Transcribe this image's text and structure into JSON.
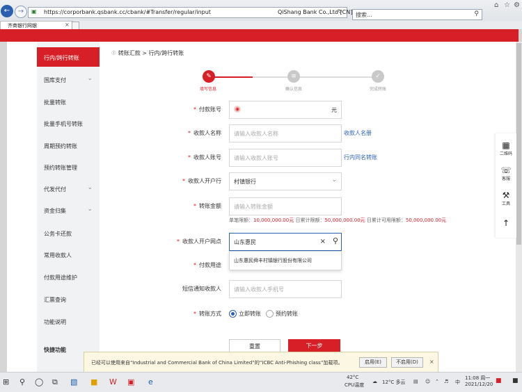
{
  "browser": {
    "url": "https://corporbank.qsbank.cc/cbank/#Transfer/regular/input",
    "cert_name": "QiShang Bank Co.,Ltd [CN]",
    "search_placeholder": "搜索...",
    "tab_title": "齐商银行网银"
  },
  "breadcrumb": "转账汇款 > 行内/跨行转账",
  "sidebar": {
    "items": [
      {
        "label": "行内/跨行转账",
        "active": true
      },
      {
        "label": "国库支付",
        "has_chevron": true
      },
      {
        "label": "批量转账"
      },
      {
        "label": "批量手机号转账"
      },
      {
        "label": "周期预约转账"
      },
      {
        "label": "预约转账管理"
      },
      {
        "label": "代发代付",
        "has_chevron": true
      },
      {
        "label": "资金归集",
        "has_chevron": true
      },
      {
        "label": "公务卡还款"
      },
      {
        "label": "常用收款人"
      },
      {
        "label": "付款用途维护"
      },
      {
        "label": "汇票查询"
      },
      {
        "label": "功能说明"
      },
      {
        "label": "快捷功能"
      }
    ]
  },
  "steps": [
    {
      "label": "填写信息",
      "state": "active"
    },
    {
      "label": "确认信息",
      "state": "pending"
    },
    {
      "label": "完成转账",
      "state": "pending"
    }
  ],
  "form": {
    "payer_account": {
      "label": "付款账号",
      "unit": "元"
    },
    "payee_name": {
      "label": "收款人名称",
      "placeholder": "请输入收款人名称",
      "link": "收款人名册"
    },
    "payee_account": {
      "label": "收款人账号",
      "placeholder": "请输入收款人账号",
      "link": "行内同名转账"
    },
    "payee_bank": {
      "label": "收款人开户行",
      "value": "村镇银行"
    },
    "amount": {
      "label": "转账金额",
      "placeholder": "请输入转账金额"
    },
    "limits": {
      "single_label": "单笔限额：",
      "single_value": "10,000,000.00元",
      "daily_label": " 日累计限额：",
      "daily_value": "50,000,000.00元",
      "avail_label": " 日累计可用限额：",
      "avail_value": "50,000,000.00元"
    },
    "branch": {
      "label": "收款人开户网点",
      "value": "山东惠民"
    },
    "branch_option": "山东惠民舜丰村镇银行股份有限公司",
    "purpose": {
      "label": "付款用途"
    },
    "sms": {
      "label": "短信通知收款人",
      "placeholder": "请输入收款人手机号"
    },
    "method": {
      "label": "转账方式",
      "options": [
        "立即转账",
        "预约转账"
      ],
      "selected": 0
    },
    "reset_label": "重置",
    "next_label": "下一步"
  },
  "float_panel": [
    {
      "icon": "qrcode-icon",
      "label": "二维码"
    },
    {
      "icon": "headset-icon",
      "label": "客服"
    },
    {
      "icon": "wrench-icon",
      "label": "工具"
    },
    {
      "icon": "arrow-up-icon",
      "label": ""
    }
  ],
  "notification": {
    "text": "已经可以使用来自“Industrial and Commercial Bank of China Limited”的“ICBC Anti-Phishing class”加载项。",
    "enable_label": "启用(E)",
    "disable_label": "不启用(D)"
  },
  "taskbar": {
    "temp": "42°C",
    "cpu": "CPU温度",
    "weather": "12°C 多云",
    "ime": "中",
    "time": "11:08 周一",
    "date": "2021/12/20"
  },
  "colors": {
    "brand_red": "#d61f26",
    "link_blue": "#2b5fb5"
  }
}
